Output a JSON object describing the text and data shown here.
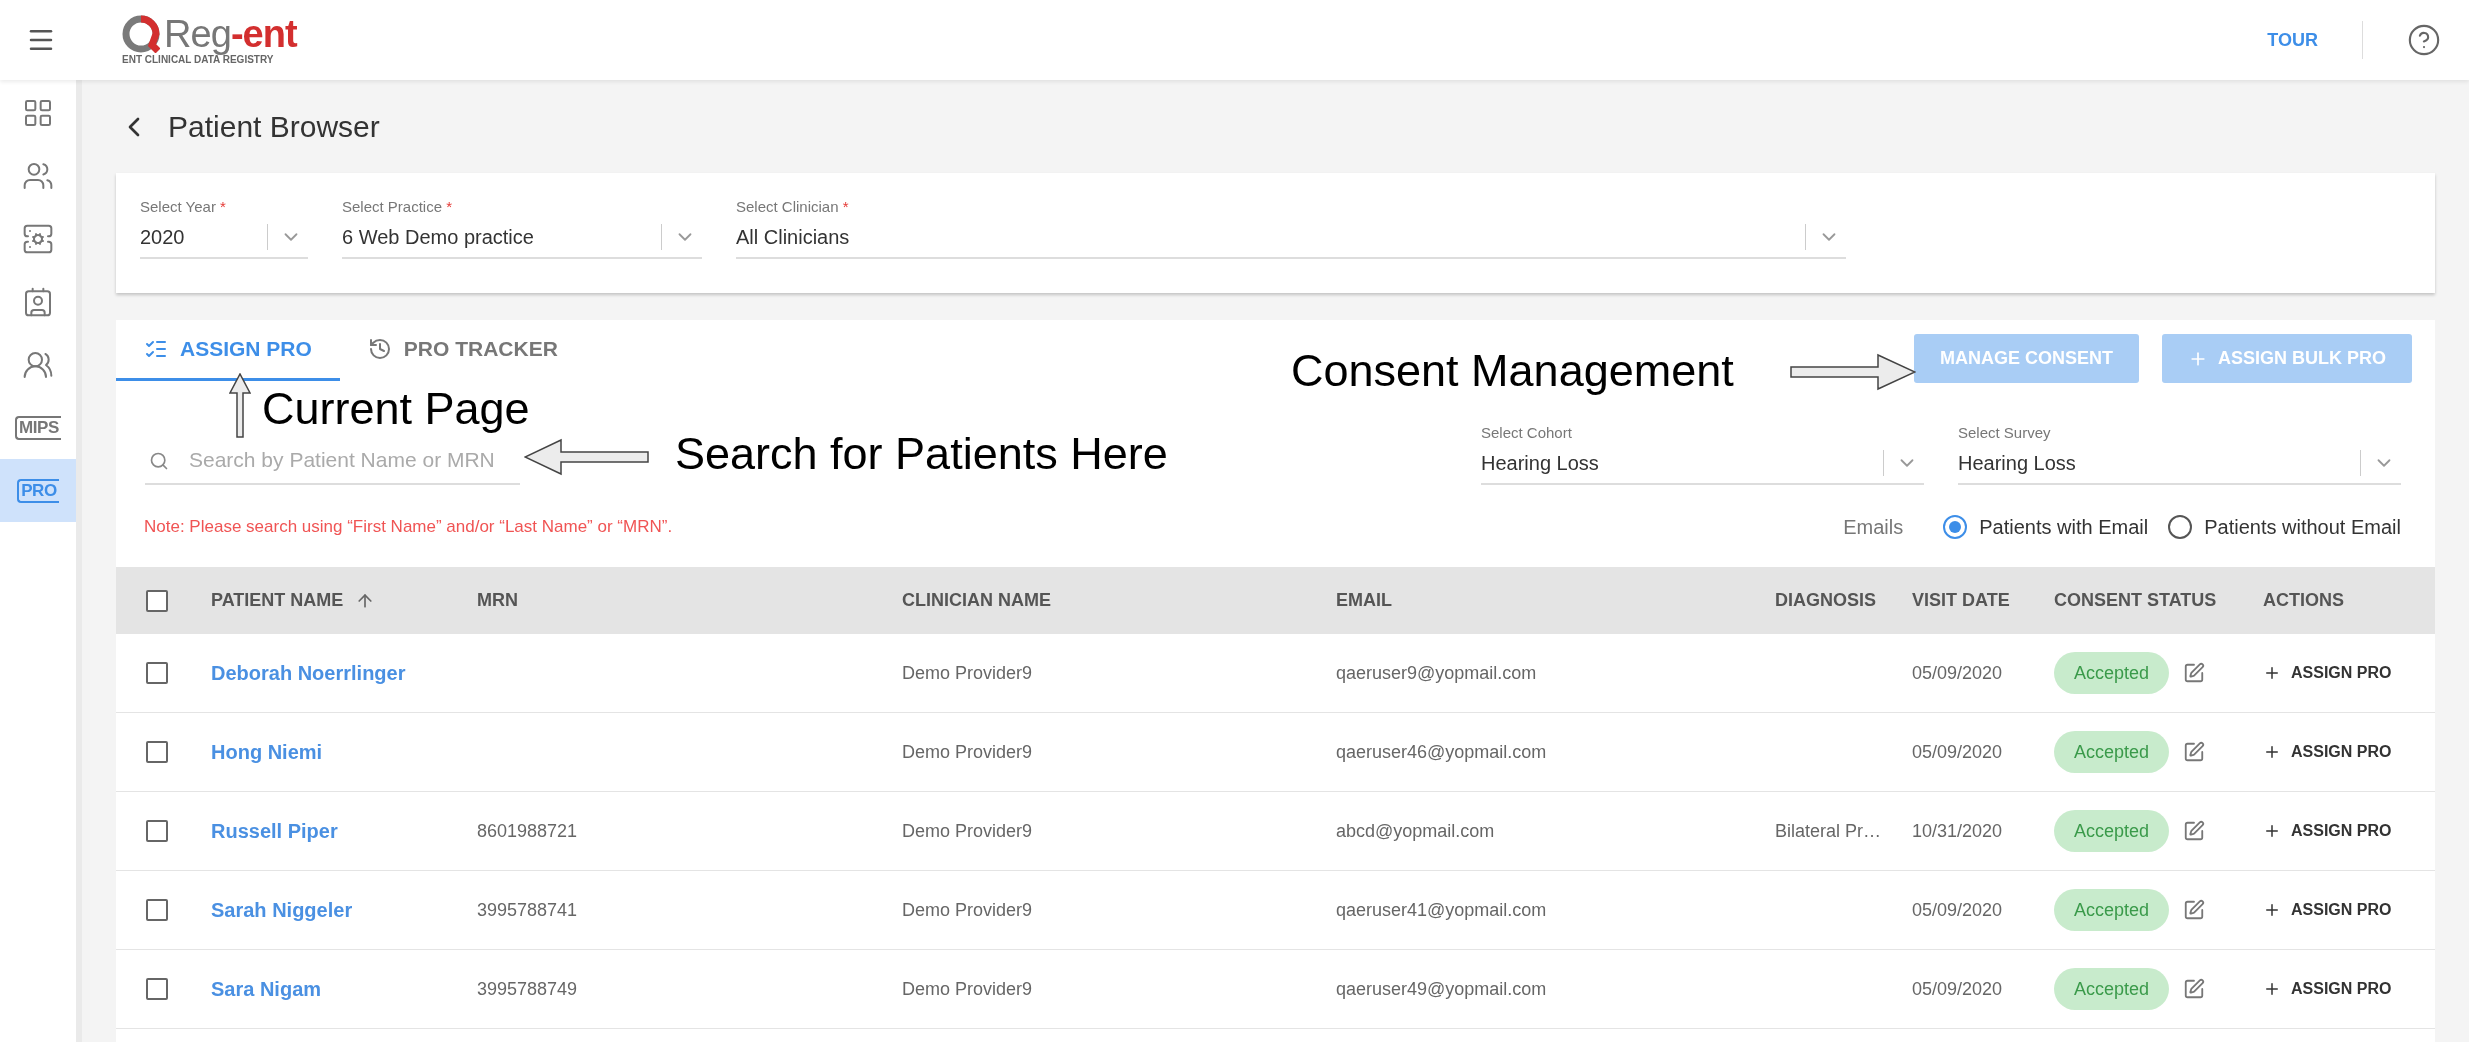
{
  "top_bar": {
    "logo": {
      "name_main": "Reg",
      "name_accent": "-ent",
      "tagline": "ENT CLINICAL DATA REGISTRY"
    },
    "tour_link": "TOUR"
  },
  "sidebar": {
    "items": [
      {
        "kind": "tiles",
        "selected": false
      },
      {
        "kind": "people",
        "selected": false
      },
      {
        "kind": "server",
        "selected": false
      },
      {
        "kind": "contact",
        "selected": false
      },
      {
        "kind": "group",
        "selected": false
      },
      {
        "kind": "text",
        "label": "MIPS",
        "selected": false
      },
      {
        "kind": "text",
        "label": "PRO",
        "selected": true
      }
    ]
  },
  "page_title": "Patient Browser",
  "filters": [
    {
      "label": "Select Year",
      "required_mark": "*",
      "value": "2020"
    },
    {
      "label": "Select Practice",
      "required_mark": "*",
      "value": "6 Web Demo practice"
    },
    {
      "label": "Select Clinician",
      "required_mark": "*",
      "value": "All Clinicians"
    }
  ],
  "tabs": [
    {
      "label": "ASSIGN PRO",
      "kind": "list",
      "selected": true
    },
    {
      "label": "PRO TRACKER",
      "kind": "history",
      "selected": false
    }
  ],
  "buttons": [
    {
      "label": "MANAGE CONSENT",
      "disabled": true,
      "kind": "plain"
    },
    {
      "label": "ASSIGN BULK PRO",
      "disabled": true,
      "kind": "add"
    }
  ],
  "search": {
    "placeholder": "Search by Patient Name or MRN"
  },
  "cohort_select": {
    "label": "Select Cohort",
    "value": "Hearing Loss"
  },
  "survey_select": {
    "label": "Select Survey",
    "value": "Hearing Loss"
  },
  "note": "Note: Please search using “First Name” and/or “Last Name” or “MRN”.",
  "emails": {
    "label": "Emails",
    "options": [
      {
        "label": "Patients with Email",
        "selected": true
      },
      {
        "label": "Patients without Email",
        "selected": false
      }
    ]
  },
  "table": {
    "select_all_checked": false,
    "columns": [
      "PATIENT NAME",
      "MRN",
      "CLINICIAN NAME",
      "EMAIL",
      "DIAGNOSIS",
      "VISIT DATE",
      "CONSENT STATUS",
      "ACTIONS"
    ],
    "rows": [
      {
        "checked": false,
        "patient_name": "Deborah Noerrlinger",
        "mrn": "",
        "clinician": "Demo Provider9",
        "email": "qaeruser9@yopmail.com",
        "diagnosis": "",
        "visit_date": "05/09/2020",
        "consent_status": "Accepted",
        "action": "ASSIGN PRO"
      },
      {
        "checked": false,
        "patient_name": "Hong Niemi",
        "mrn": "",
        "clinician": "Demo Provider9",
        "email": "qaeruser46@yopmail.com",
        "diagnosis": "",
        "visit_date": "05/09/2020",
        "consent_status": "Accepted",
        "action": "ASSIGN PRO"
      },
      {
        "checked": false,
        "patient_name": "Russell Piper",
        "mrn": "8601988721",
        "clinician": "Demo Provider9",
        "email": "abcd@yopmail.com",
        "diagnosis": "Bilateral Pr…",
        "visit_date": "10/31/2020",
        "consent_status": "Accepted",
        "action": "ASSIGN PRO"
      },
      {
        "checked": false,
        "patient_name": "Sarah Niggeler",
        "mrn": "3995788741",
        "clinician": "Demo Provider9",
        "email": "qaeruser41@yopmail.com",
        "diagnosis": "",
        "visit_date": "05/09/2020",
        "consent_status": "Accepted",
        "action": "ASSIGN PRO"
      },
      {
        "checked": false,
        "patient_name": "Sara Nigam",
        "mrn": "3995788749",
        "clinician": "Demo Provider9",
        "email": "qaeruser49@yopmail.com",
        "diagnosis": "",
        "visit_date": "05/09/2020",
        "consent_status": "Accepted",
        "action": "ASSIGN PRO"
      }
    ]
  },
  "annotations": [
    {
      "text": "Current Page",
      "kind": "up"
    },
    {
      "text": "Search for Patients Here",
      "kind": "left"
    },
    {
      "text": "Consent Management",
      "kind": "right"
    }
  ]
}
